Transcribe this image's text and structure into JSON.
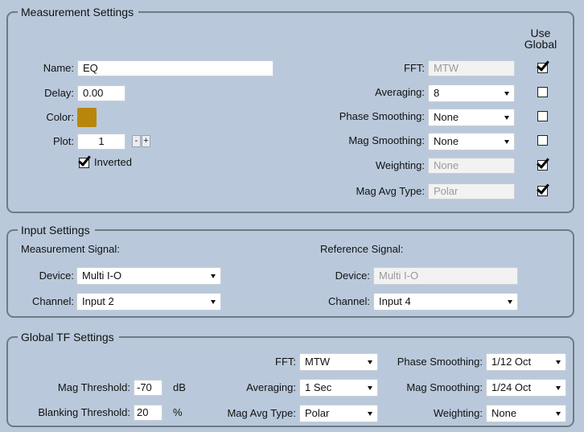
{
  "measurement": {
    "legend": "Measurement Settings",
    "use_global_header": [
      "Use",
      "Global"
    ],
    "name_label": "Name:",
    "name_value": "EQ",
    "delay_label": "Delay:",
    "delay_value": "0.00",
    "color_label": "Color:",
    "color_value": "#b8860b",
    "plot_label": "Plot:",
    "plot_value": "1",
    "plot_minus": "-",
    "plot_plus": "+",
    "inverted_label": "Inverted",
    "inverted_checked": true,
    "fft_label": "FFT:",
    "fft_value": "MTW",
    "averaging_label": "Averaging:",
    "averaging_value": "8",
    "phase_smoothing_label": "Phase Smoothing:",
    "phase_smoothing_value": "None",
    "mag_smoothing_label": "Mag Smoothing:",
    "mag_smoothing_value": "None",
    "weighting_label": "Weighting:",
    "weighting_value": "None",
    "mag_avg_type_label": "Mag Avg Type:",
    "mag_avg_type_value": "Polar",
    "use_global": {
      "fft": true,
      "averaging": false,
      "phase_smoothing": false,
      "mag_smoothing": false,
      "weighting": true,
      "mag_avg_type": true
    }
  },
  "input": {
    "legend": "Input Settings",
    "measurement_signal_label": "Measurement Signal:",
    "reference_signal_label": "Reference Signal:",
    "device_label": "Device:",
    "channel_label": "Channel:",
    "meas_device_value": "Multi I-O",
    "meas_channel_value": "Input 2",
    "ref_device_value": "Multi I-O",
    "ref_channel_value": "Input 4"
  },
  "global_tf": {
    "legend": "Global TF Settings",
    "fft_label": "FFT:",
    "fft_value": "MTW",
    "averaging_label": "Averaging:",
    "averaging_value": "1 Sec",
    "mag_avg_type_label": "Mag Avg Type:",
    "mag_avg_type_value": "Polar",
    "phase_smoothing_label": "Phase Smoothing:",
    "phase_smoothing_value": "1/12 Oct",
    "mag_smoothing_label": "Mag Smoothing:",
    "mag_smoothing_value": "1/24 Oct",
    "weighting_label": "Weighting:",
    "weighting_value": "None",
    "mag_threshold_label": "Mag Threshold:",
    "mag_threshold_value": "-70",
    "mag_threshold_unit": "dB",
    "blanking_threshold_label": "Blanking Threshold:",
    "blanking_threshold_value": "20",
    "blanking_threshold_unit": "%"
  }
}
